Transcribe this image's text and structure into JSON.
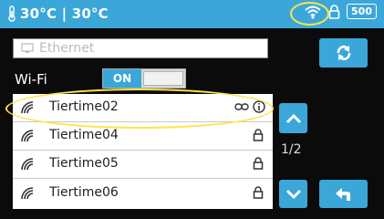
{
  "status": {
    "temperature": "30°C | 30°C",
    "badge": "500",
    "icons": [
      "thermometer-icon",
      "wifi-icon",
      "lock-icon",
      "badge-500"
    ]
  },
  "ethernet": {
    "label": "Ethernet"
  },
  "wifi": {
    "label": "Wi-Fi",
    "toggle_label": "ON"
  },
  "networks": [
    {
      "ssid": "Tiertime02",
      "connected": true
    },
    {
      "ssid": "Tiertime04",
      "connected": false
    },
    {
      "ssid": "Tiertime05",
      "connected": false
    },
    {
      "ssid": "Tiertime06",
      "connected": false
    }
  ],
  "pagination": {
    "text": "1/2"
  },
  "colors": {
    "accent": "#3aa7d8",
    "highlight": "#ffe34a"
  }
}
